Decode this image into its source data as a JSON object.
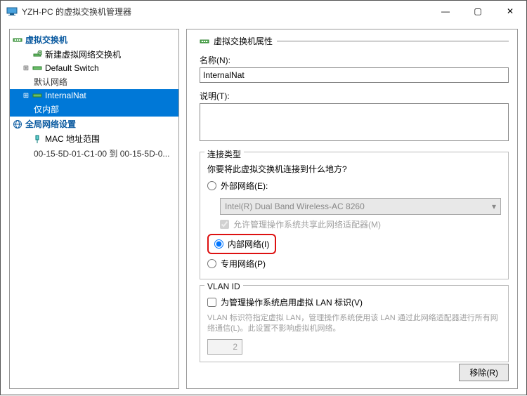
{
  "window": {
    "title": "YZH-PC 的虚拟交换机管理器",
    "min": "—",
    "max": "▢",
    "close": "✕"
  },
  "tree": {
    "section1": "虚拟交换机",
    "new_switch": "新建虚拟网络交换机",
    "default_switch": "Default Switch",
    "default_switch_sub": "默认网络",
    "internal_nat": "InternalNat",
    "internal_nat_sub": "仅内部",
    "section2": "全局网络设置",
    "mac_range": "MAC 地址范围",
    "mac_range_sub": "00-15-5D-01-C1-00 到 00-15-5D-0..."
  },
  "props": {
    "header": "虚拟交换机属性",
    "name_label": "名称(N):",
    "name_value": "InternalNat",
    "desc_label": "说明(T):",
    "desc_value": "",
    "conn_legend": "连接类型",
    "conn_question": "你要将此虚拟交换机连接到什么地方?",
    "external_label": "外部网络(E):",
    "adapter": "Intel(R) Dual Band Wireless-AC 8260",
    "allow_mgmt": "允许管理操作系统共享此网络适配器(M)",
    "internal_label": "内部网络(I)",
    "private_label": "专用网络(P)",
    "vlan_legend": "VLAN ID",
    "vlan_enable": "为管理操作系统启用虚拟 LAN 标识(V)",
    "vlan_note": "VLAN 标识符指定虚拟 LAN，管理操作系统使用该 LAN 通过此网络适配器进行所有网络通信(L)。此设置不影响虚拟机网络。",
    "vlan_value": "2"
  },
  "buttons": {
    "remove": "移除(R)"
  },
  "expander_plus": "⊞",
  "expander_minus": "⊟",
  "combo_caret": "▾"
}
